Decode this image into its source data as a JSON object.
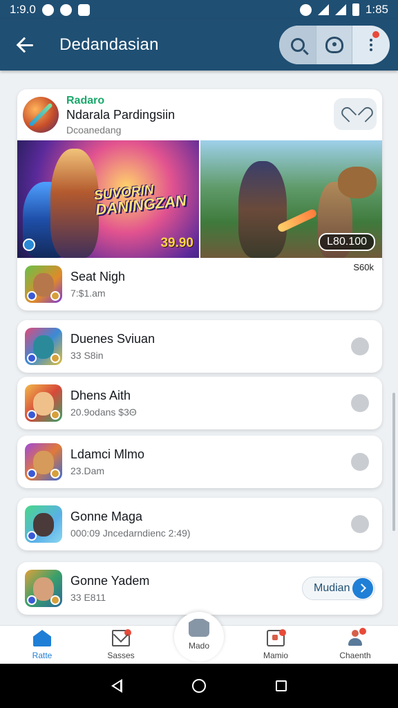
{
  "status_bar": {
    "time_left": "1:9.0",
    "time_right": "1:85"
  },
  "app_bar": {
    "title": "Dedandasian"
  },
  "featured": {
    "category": "Radaro",
    "title": "Ndarala Pardingsiin",
    "subtitle": "Dcoanedang",
    "banner_logo_line1": "SUVORIN",
    "banner_logo_line2": "DANINGZAN",
    "banner_price_left": "39.90",
    "banner_price_right": "L80.100",
    "tag": "S60k",
    "row": {
      "title": "Seat Nigh",
      "subtitle": "7:$1.am"
    }
  },
  "apps": [
    {
      "title": "Duenes Sviuan",
      "subtitle": "33 S8in"
    },
    {
      "title": "Dhens Aith",
      "subtitle": "20.9odans $3Θ"
    },
    {
      "title": "Ldamci Mlmo",
      "subtitle": "23.Dam"
    },
    {
      "title": "Gonne Maga",
      "subtitle": "000:09 Jncedarndienc 2:49)"
    },
    {
      "title": "Gonne Yadem",
      "subtitle": "33 E811",
      "button": "Mudian"
    }
  ],
  "bottom_nav": {
    "items": [
      {
        "label": "Ratte"
      },
      {
        "label": "Sasses"
      },
      {
        "label": "Mado"
      },
      {
        "label": "Mamio"
      },
      {
        "label": "Chaenth"
      }
    ]
  },
  "colors": {
    "primary": "#1f4f73",
    "accent": "#1f7fd6",
    "badge": "#e84a3a",
    "category": "#1aa86a"
  },
  "icons": [
    "back-arrow-icon",
    "search-icon",
    "gamepad-icon",
    "more-vert-icon",
    "heart-icon",
    "home-icon",
    "mail-icon",
    "games-icon",
    "shop-icon",
    "user-icon",
    "chevron-right-icon"
  ]
}
